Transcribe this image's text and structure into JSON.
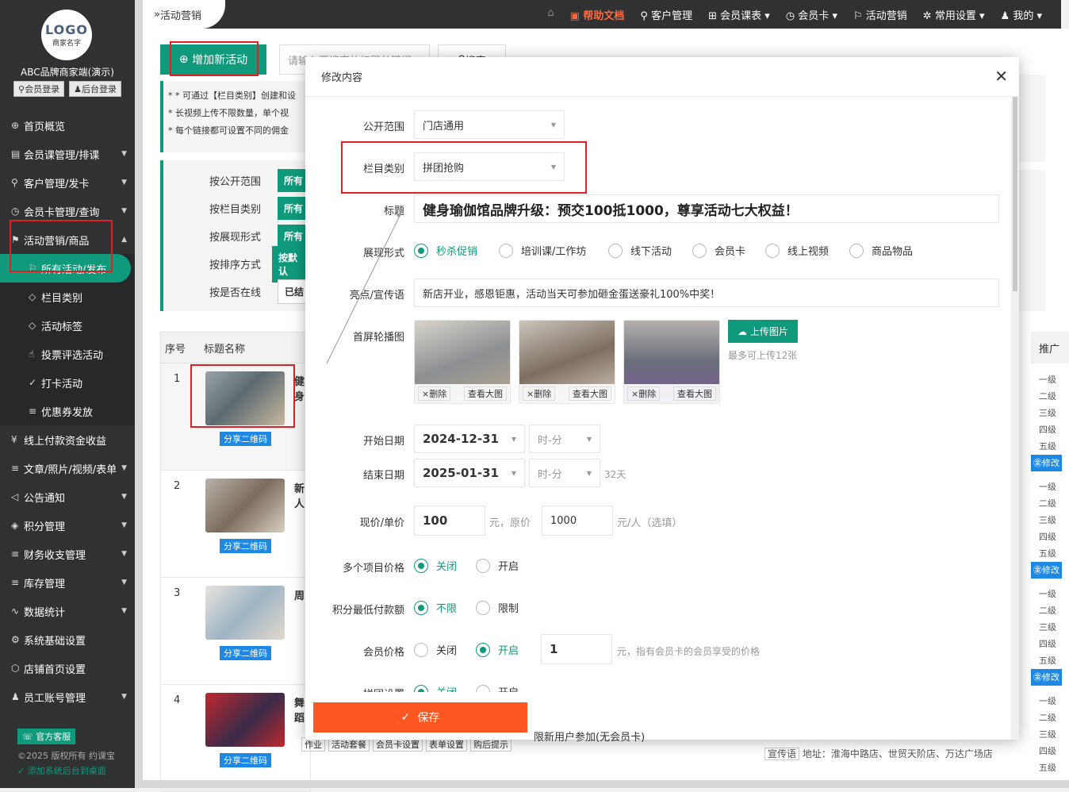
{
  "sidebar": {
    "logo_text": "LOGO",
    "logo_sub": "商家名字",
    "brand": "ABC品牌商家端(演示)",
    "member_login": "会员登录",
    "admin_login": "后台登录",
    "items": [
      {
        "label": "首页概览",
        "icon": "globe-icon",
        "arrow": false
      },
      {
        "label": "会员课管理/排课",
        "icon": "document-icon",
        "arrow": true
      },
      {
        "label": "客户管理/发卡",
        "icon": "user-icon",
        "arrow": true
      },
      {
        "label": "会员卡管理/查询",
        "icon": "clock-icon",
        "arrow": true
      },
      {
        "label": "活动营销/商品",
        "icon": "flag-icon",
        "arrow": true
      }
    ],
    "subitems": [
      {
        "label": "所有活动/发布",
        "icon": "flag-icon"
      },
      {
        "label": "栏目类别",
        "icon": "tag-icon"
      },
      {
        "label": "活动标签",
        "icon": "tag-icon"
      },
      {
        "label": "投票评选活动",
        "icon": "thumb-icon"
      },
      {
        "label": "打卡活动",
        "icon": "check-icon"
      },
      {
        "label": "优惠券发放",
        "icon": "sliders-icon"
      }
    ],
    "items2": [
      {
        "label": "线上付款资金收益",
        "icon": "yen-icon",
        "arrow": false
      },
      {
        "label": "文章/照片/视频/表单",
        "icon": "sliders-icon",
        "arrow": true
      },
      {
        "label": "公告通知",
        "icon": "speaker-icon",
        "arrow": true
      },
      {
        "label": "积分管理",
        "icon": "diamond-icon",
        "arrow": true
      },
      {
        "label": "财务收支管理",
        "icon": "sliders-icon",
        "arrow": true
      },
      {
        "label": "库存管理",
        "icon": "sliders-icon",
        "arrow": true
      },
      {
        "label": "数据统计",
        "icon": "pulse-icon",
        "arrow": true
      },
      {
        "label": "系统基础设置",
        "icon": "gear-icon",
        "arrow": false
      },
      {
        "label": "店铺首页设置",
        "icon": "cube-icon",
        "arrow": false
      },
      {
        "label": "员工账号管理",
        "icon": "person-icon",
        "arrow": true
      }
    ],
    "service": "官方客服",
    "copyright": "©2025 版权所有 约课宝",
    "add_desktop": "添加系统后台到桌面"
  },
  "topbar": {
    "crumb": "活动营销",
    "nav": [
      "帮助文档",
      "客户管理",
      "会员课表",
      "会员卡",
      "活动营销",
      "常用设置",
      "我的"
    ]
  },
  "main": {
    "add_btn": "增加新活动",
    "search_placeholder": "请输入要搜索的标题关键词",
    "search_btn": "搜索",
    "notes": [
      "* * 可通过【栏目类别】创建和设",
      "* 长视频上传不限数量，单个视",
      "* 每个链接都可设置不同的佣金"
    ],
    "filters": [
      {
        "label": "按公开范围",
        "btn": "所有"
      },
      {
        "label": "按栏目类别",
        "btn": "所有"
      },
      {
        "label": "按展现形式",
        "btn": "所有"
      },
      {
        "label": "按排序方式",
        "btn": "按默认"
      },
      {
        "label": "按是否在线",
        "btn": "已结"
      }
    ],
    "col_no": "序号",
    "col_title": "标题名称",
    "col_promo": "推广",
    "rows": [
      {
        "no": "1",
        "share": "分享二维码",
        "t": "健身"
      },
      {
        "no": "2",
        "share": "分享二维码",
        "t": "新人"
      },
      {
        "no": "3",
        "share": "分享二维码",
        "t": "周"
      },
      {
        "no": "4",
        "share": "分享二维码",
        "t": "舞蹈"
      }
    ],
    "levels": [
      "一级",
      "二级",
      "三级",
      "四级",
      "五级"
    ],
    "modify": "修改",
    "row4_tags": [
      "作业",
      "活动套餐",
      "会员卡设置",
      "表单设置",
      "购后提示"
    ],
    "row4_promo": "宣传语",
    "row4_addr": "地址：淮海中路店、世贸天阶店、万达广场店"
  },
  "modal": {
    "title": "修改内容",
    "scope_label": "公开范围",
    "scope_value": "门店通用",
    "cat_label": "栏目类别",
    "cat_value": "拼团抢购",
    "title_label": "标题",
    "title_value": "健身瑜伽馆品牌升级：预交100抵1000，尊享活动七大权益！",
    "form_label": "展现形式",
    "forms": [
      "秒杀促销",
      "培训课/工作坊",
      "线下活动",
      "会员卡",
      "线上视频",
      "商品物品"
    ],
    "slogan_label": "亮点/宣传语",
    "slogan_value": "新店开业，感恩钜惠，活动当天可参加砸金蛋送豪礼100%中奖！",
    "carousel_label": "首屏轮播图",
    "del": "×删除",
    "view": "查看大图",
    "upload": "上传图片",
    "upload_note": "最多可上传12张",
    "start_label": "开始日期",
    "start_date": "2024-12-31",
    "end_label": "结束日期",
    "end_date": "2025-01-31",
    "time_ph": "时-分",
    "days": "32天",
    "price_label": "现价/单价",
    "price": "100",
    "yuan_orig": "元，原价",
    "orig_price": "1000",
    "per_person": "元/人（选填）",
    "multi_label": "多个项目价格",
    "off": "关闭",
    "on": "开启",
    "points_label": "积分最低付款额",
    "unlimited": "不限",
    "limit": "限制",
    "member_label": "会员价格",
    "member_price": "1",
    "member_note": "元，指有会员卡的会员享受的价格",
    "group_label": "拼团设置",
    "save": "保存",
    "newuser": "限新用户参加(无会员卡)"
  }
}
